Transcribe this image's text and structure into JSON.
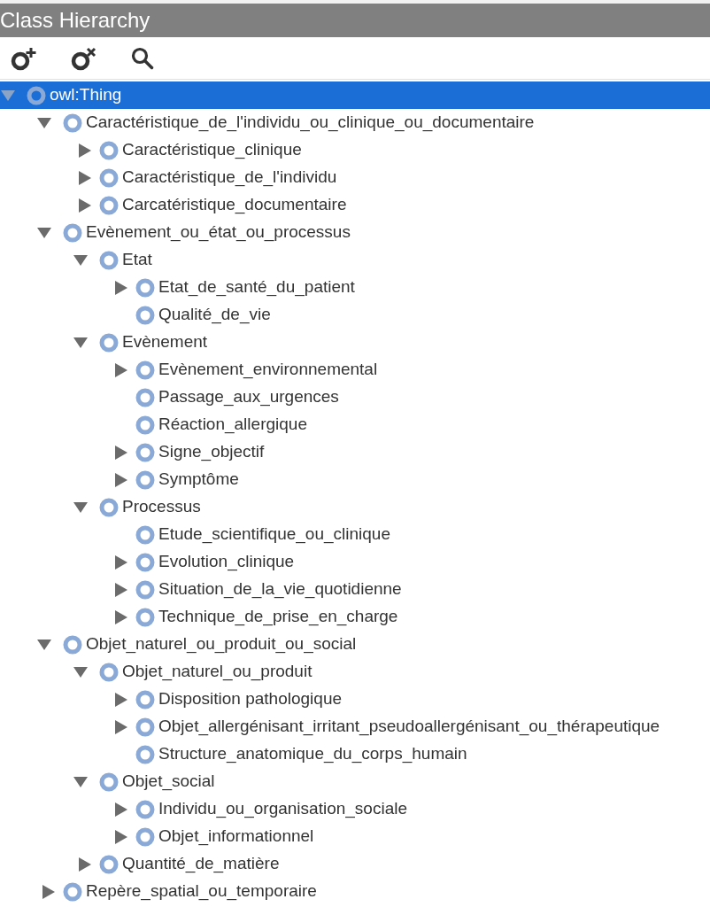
{
  "panel": {
    "title": "Class Hierarchy"
  },
  "toolbar": [
    {
      "kind": "add"
    },
    {
      "kind": "delete"
    },
    {
      "kind": "search"
    }
  ],
  "tree": [
    {
      "label": "owl:Thing",
      "selected": true,
      "kind": "branch",
      "expanded": true,
      "children": [
        {
          "label": "Caractéristique_de_l'individu_ou_clinique_ou_documentaire",
          "selected": false,
          "kind": "branch",
          "expanded": true,
          "children": [
            {
              "label": "Caractéristique_clinique",
              "selected": false,
              "kind": "branch",
              "expanded": false
            },
            {
              "label": "Caractéristique_de_l'individu",
              "selected": false,
              "kind": "branch",
              "expanded": false
            },
            {
              "label": "Carcatéristique_documentaire",
              "selected": false,
              "kind": "branch",
              "expanded": false
            }
          ]
        },
        {
          "label": "Evènement_ou_état_ou_processus",
          "selected": false,
          "kind": "branch",
          "expanded": true,
          "children": [
            {
              "label": "Etat",
              "selected": false,
              "kind": "branch",
              "expanded": true,
              "children": [
                {
                  "label": "Etat_de_santé_du_patient",
                  "selected": false,
                  "kind": "branch",
                  "expanded": false
                },
                {
                  "label": "Qualité_de_vie",
                  "selected": false,
                  "kind": "leaf"
                }
              ]
            },
            {
              "label": "Evènement",
              "selected": false,
              "kind": "branch",
              "expanded": true,
              "children": [
                {
                  "label": "Evènement_environnemental",
                  "selected": false,
                  "kind": "branch",
                  "expanded": false
                },
                {
                  "label": "Passage_aux_urgences",
                  "selected": false,
                  "kind": "leaf"
                },
                {
                  "label": "Réaction_allergique",
                  "selected": false,
                  "kind": "leaf"
                },
                {
                  "label": "Signe_objectif",
                  "selected": false,
                  "kind": "branch",
                  "expanded": false
                },
                {
                  "label": "Symptôme",
                  "selected": false,
                  "kind": "branch",
                  "expanded": false
                }
              ]
            },
            {
              "label": "Processus",
              "selected": false,
              "kind": "branch",
              "expanded": true,
              "children": [
                {
                  "label": "Etude_scientifique_ou_clinique",
                  "selected": false,
                  "kind": "leaf"
                },
                {
                  "label": "Evolution_clinique",
                  "selected": false,
                  "kind": "branch",
                  "expanded": false
                },
                {
                  "label": "Situation_de_la_vie_quotidienne",
                  "selected": false,
                  "kind": "branch",
                  "expanded": false
                },
                {
                  "label": "Technique_de_prise_en_charge",
                  "selected": false,
                  "kind": "branch",
                  "expanded": false
                }
              ]
            }
          ]
        },
        {
          "label": "Objet_naturel_ou_produit_ou_social",
          "selected": false,
          "kind": "branch",
          "expanded": true,
          "children": [
            {
              "label": "Objet_naturel_ou_produit",
              "selected": false,
              "kind": "branch",
              "expanded": true,
              "children": [
                {
                  "label": "Disposition pathologique",
                  "selected": false,
                  "kind": "branch",
                  "expanded": false
                },
                {
                  "label": "Objet_allergénisant_irritant_pseudoallergénisant_ou_thérapeutique",
                  "selected": false,
                  "kind": "branch",
                  "expanded": false
                },
                {
                  "label": "Structure_anatomique_du_corps_humain",
                  "selected": false,
                  "kind": "leaf"
                }
              ]
            },
            {
              "label": "Objet_social",
              "selected": false,
              "kind": "branch",
              "expanded": true,
              "children": [
                {
                  "label": "Individu_ou_organisation_sociale",
                  "selected": false,
                  "kind": "branch",
                  "expanded": false
                },
                {
                  "label": "Objet_informationnel",
                  "selected": false,
                  "kind": "branch",
                  "expanded": false
                }
              ]
            },
            {
              "label": "Quantité_de_matière",
              "selected": false,
              "kind": "branch",
              "expanded": false
            }
          ]
        },
        {
          "label": "Repère_spatial_ou_temporaire",
          "selected": false,
          "kind": "branch",
          "expanded": false
        }
      ]
    }
  ]
}
